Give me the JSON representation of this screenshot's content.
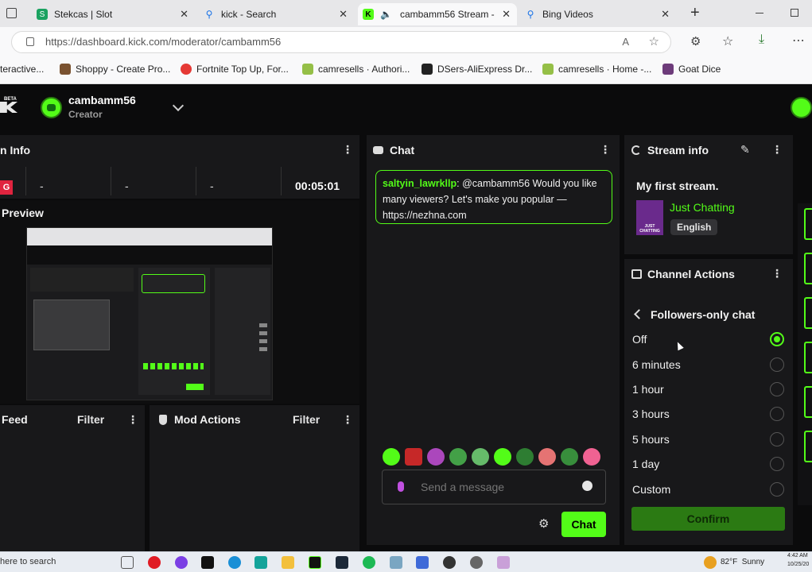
{
  "browser": {
    "tabs": [
      {
        "label": "Stekcas | Slot",
        "close": "✕"
      },
      {
        "label": "kick - Search",
        "close": "✕"
      },
      {
        "label": "cambamm56 Stream -",
        "close": "✕"
      },
      {
        "label": "Bing Videos",
        "close": "✕"
      }
    ],
    "new_tab": "+",
    "url": "https://dashboard.kick.com/moderator/cambamm56",
    "bookmarks": [
      "teractive...",
      "Shoppy - Create Pro...",
      "Fortnite Top Up, For...",
      "camresells · Authori...",
      "DSers-AliExpress Dr...",
      "camresells · Home -...",
      "Goat Dice"
    ]
  },
  "header": {
    "beta": "BETA",
    "username": "cambamm56",
    "role": "Creator"
  },
  "session_info": {
    "title": "n Info",
    "badge": "G",
    "stats": [
      "-",
      "-",
      "-"
    ],
    "timer": "00:05:01"
  },
  "preview": {
    "title": "Preview"
  },
  "feed": {
    "title": "Feed",
    "filter": "Filter"
  },
  "mod_actions": {
    "title": "Mod Actions",
    "filter": "Filter"
  },
  "chat": {
    "title": "Chat",
    "message": {
      "user": "saltyin_lawrkllp",
      "colon": ":",
      "text": "@cambamm56 Would you like many viewers? Let's make you popular — https://nezhna.com"
    },
    "placeholder": "Send a message",
    "send_label": "Chat"
  },
  "stream_info": {
    "title": "Stream info",
    "stream_title": "My first stream.",
    "category": "Just Chatting",
    "language": "English",
    "thumb_text": "JUST CHATTING"
  },
  "channel_actions": {
    "title": "Channel Actions",
    "submenu_title": "Followers-only chat",
    "options": [
      {
        "label": "Off",
        "selected": true
      },
      {
        "label": "6 minutes",
        "selected": false
      },
      {
        "label": "1 hour",
        "selected": false
      },
      {
        "label": "3 hours",
        "selected": false
      },
      {
        "label": "5 hours",
        "selected": false
      },
      {
        "label": "1 day",
        "selected": false
      },
      {
        "label": "Custom",
        "selected": false
      }
    ],
    "confirm": "Confirm"
  },
  "taskbar": {
    "search": "here to search",
    "weather": "82°F  Sunny",
    "time": "4:42 AM",
    "date": "10/25/20"
  },
  "colors": {
    "accent": "#53fc18",
    "panel": "#18181a",
    "background": "#0b0b0c"
  }
}
